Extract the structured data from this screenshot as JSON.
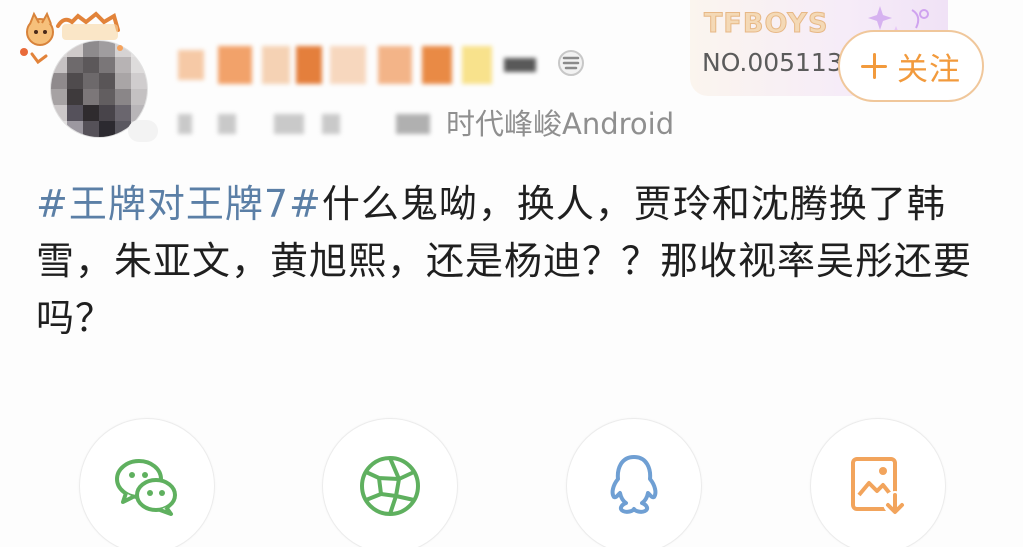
{
  "header": {
    "source_line": "时代峰峻Android"
  },
  "fan_card": {
    "group_name": "TFBOYS",
    "fan_number": "NO.005113"
  },
  "follow_button": {
    "label": "关注"
  },
  "post": {
    "hashtag": "#王牌对王牌7#",
    "body": "什么鬼呦，换人，贾玲和沈腾换了韩雪，朱亚文，黄旭熙，还是杨迪？？那收视率吴彤还要吗？"
  },
  "share": {
    "items": [
      {
        "icon": "wechat-icon"
      },
      {
        "icon": "moments-icon"
      },
      {
        "icon": "qq-icon"
      },
      {
        "icon": "save-image-icon"
      }
    ]
  },
  "colors": {
    "hashtag": "#5b7fa6",
    "accent": "#f29a3c",
    "green_icon": "#5fb05f",
    "blue_icon": "#6f9fd3",
    "body_text": "#1f1f1f",
    "meta_text": "#8f8f8f"
  }
}
